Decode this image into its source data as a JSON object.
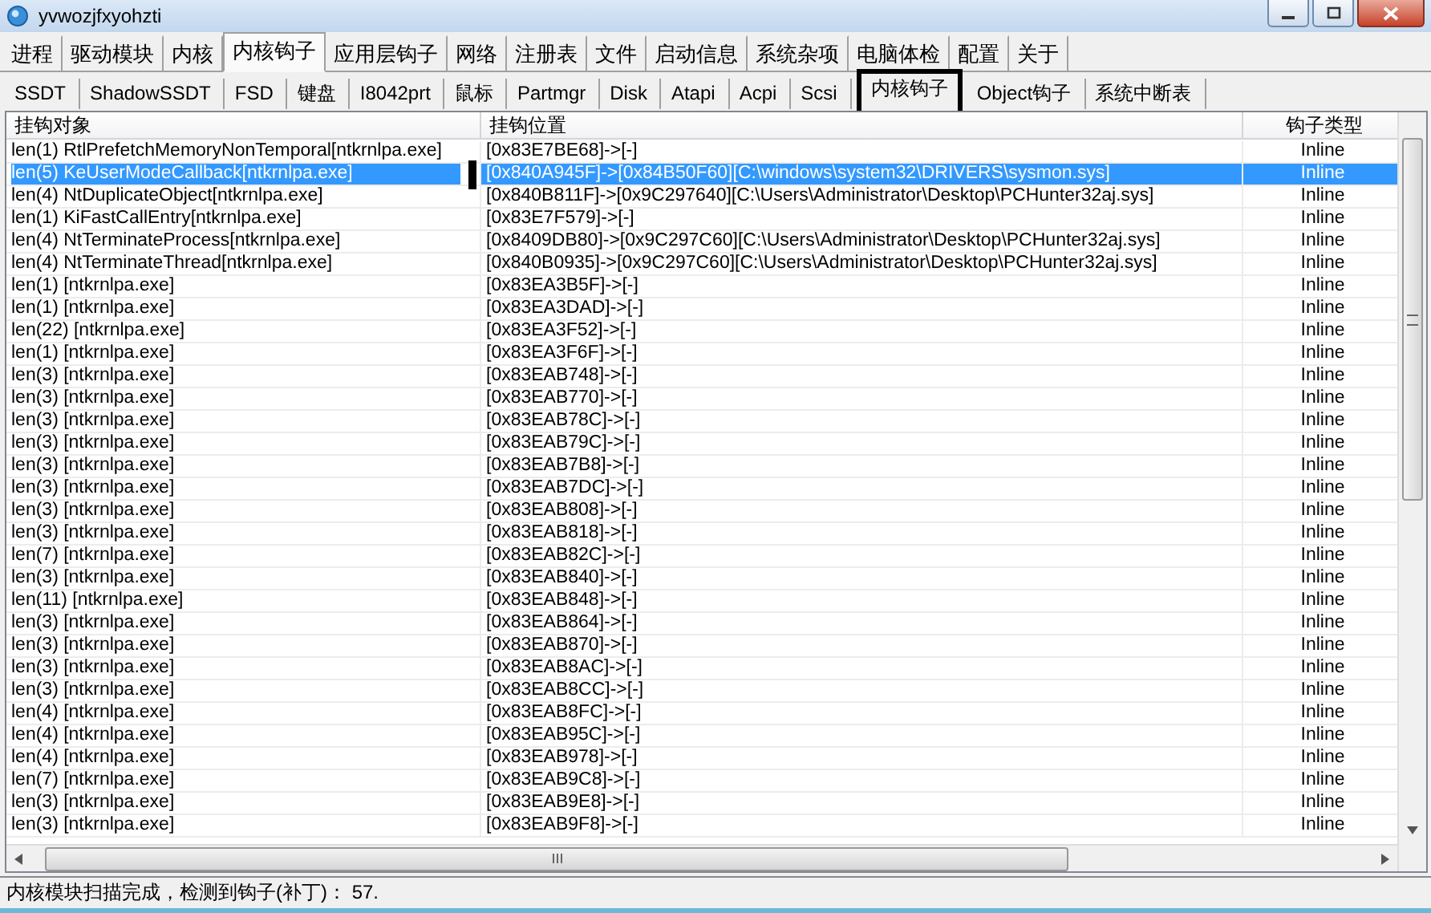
{
  "window": {
    "title": "yvwozjfxyohzti"
  },
  "tabs": [
    {
      "label": "进程",
      "selected": false
    },
    {
      "label": "驱动模块",
      "selected": false
    },
    {
      "label": "内核",
      "selected": false
    },
    {
      "label": "内核钩子",
      "selected": true
    },
    {
      "label": "应用层钩子",
      "selected": false
    },
    {
      "label": "网络",
      "selected": false
    },
    {
      "label": "注册表",
      "selected": false
    },
    {
      "label": "文件",
      "selected": false
    },
    {
      "label": "启动信息",
      "selected": false
    },
    {
      "label": "系统杂项",
      "selected": false
    },
    {
      "label": "电脑体检",
      "selected": false
    },
    {
      "label": "配置",
      "selected": false
    },
    {
      "label": "关于",
      "selected": false
    }
  ],
  "subtabs": [
    {
      "label": "SSDT",
      "selected": false
    },
    {
      "label": "ShadowSSDT",
      "selected": false
    },
    {
      "label": "FSD",
      "selected": false
    },
    {
      "label": "键盘",
      "selected": false
    },
    {
      "label": "I8042prt",
      "selected": false
    },
    {
      "label": "鼠标",
      "selected": false
    },
    {
      "label": "Partmgr",
      "selected": false
    },
    {
      "label": "Disk",
      "selected": false
    },
    {
      "label": "Atapi",
      "selected": false
    },
    {
      "label": "Acpi",
      "selected": false
    },
    {
      "label": "Scsi",
      "selected": false
    },
    {
      "label": "内核钩子",
      "selected": true
    },
    {
      "label": "Object钩子",
      "selected": false
    },
    {
      "label": "系统中断表",
      "selected": false
    }
  ],
  "table": {
    "columns": [
      "挂钩对象",
      "挂钩位置",
      "钩子类型"
    ],
    "rows": [
      {
        "object": "len(1) RtlPrefetchMemoryNonTemporal[ntkrnlpa.exe]",
        "location": "[0x83E7BE68]->[-]",
        "type": "Inline",
        "selected": false
      },
      {
        "object": "len(5) KeUserModeCallback[ntkrnlpa.exe]",
        "location": "[0x840A945F]->[0x84B50F60][C:\\windows\\system32\\DRIVERS\\sysmon.sys]",
        "type": "Inline",
        "selected": true
      },
      {
        "object": "len(4) NtDuplicateObject[ntkrnlpa.exe]",
        "location": "[0x840B811F]->[0x9C297640][C:\\Users\\Administrator\\Desktop\\PCHunter32aj.sys]",
        "type": "Inline",
        "selected": false
      },
      {
        "object": "len(1) KiFastCallEntry[ntkrnlpa.exe]",
        "location": "[0x83E7F579]->[-]",
        "type": "Inline",
        "selected": false
      },
      {
        "object": "len(4) NtTerminateProcess[ntkrnlpa.exe]",
        "location": "[0x8409DB80]->[0x9C297C60][C:\\Users\\Administrator\\Desktop\\PCHunter32aj.sys]",
        "type": "Inline",
        "selected": false
      },
      {
        "object": "len(4) NtTerminateThread[ntkrnlpa.exe]",
        "location": "[0x840B0935]->[0x9C297C60][C:\\Users\\Administrator\\Desktop\\PCHunter32aj.sys]",
        "type": "Inline",
        "selected": false
      },
      {
        "object": "len(1) [ntkrnlpa.exe]",
        "location": "[0x83EA3B5F]->[-]",
        "type": "Inline",
        "selected": false
      },
      {
        "object": "len(1) [ntkrnlpa.exe]",
        "location": "[0x83EA3DAD]->[-]",
        "type": "Inline",
        "selected": false
      },
      {
        "object": "len(22) [ntkrnlpa.exe]",
        "location": "[0x83EA3F52]->[-]",
        "type": "Inline",
        "selected": false
      },
      {
        "object": "len(1) [ntkrnlpa.exe]",
        "location": "[0x83EA3F6F]->[-]",
        "type": "Inline",
        "selected": false
      },
      {
        "object": "len(3) [ntkrnlpa.exe]",
        "location": "[0x83EAB748]->[-]",
        "type": "Inline",
        "selected": false
      },
      {
        "object": "len(3) [ntkrnlpa.exe]",
        "location": "[0x83EAB770]->[-]",
        "type": "Inline",
        "selected": false
      },
      {
        "object": "len(3) [ntkrnlpa.exe]",
        "location": "[0x83EAB78C]->[-]",
        "type": "Inline",
        "selected": false
      },
      {
        "object": "len(3) [ntkrnlpa.exe]",
        "location": "[0x83EAB79C]->[-]",
        "type": "Inline",
        "selected": false
      },
      {
        "object": "len(3) [ntkrnlpa.exe]",
        "location": "[0x83EAB7B8]->[-]",
        "type": "Inline",
        "selected": false
      },
      {
        "object": "len(3) [ntkrnlpa.exe]",
        "location": "[0x83EAB7DC]->[-]",
        "type": "Inline",
        "selected": false
      },
      {
        "object": "len(3) [ntkrnlpa.exe]",
        "location": "[0x83EAB808]->[-]",
        "type": "Inline",
        "selected": false
      },
      {
        "object": "len(3) [ntkrnlpa.exe]",
        "location": "[0x83EAB818]->[-]",
        "type": "Inline",
        "selected": false
      },
      {
        "object": "len(7) [ntkrnlpa.exe]",
        "location": "[0x83EAB82C]->[-]",
        "type": "Inline",
        "selected": false
      },
      {
        "object": "len(3) [ntkrnlpa.exe]",
        "location": "[0x83EAB840]->[-]",
        "type": "Inline",
        "selected": false
      },
      {
        "object": "len(11) [ntkrnlpa.exe]",
        "location": "[0x83EAB848]->[-]",
        "type": "Inline",
        "selected": false
      },
      {
        "object": "len(3) [ntkrnlpa.exe]",
        "location": "[0x83EAB864]->[-]",
        "type": "Inline",
        "selected": false
      },
      {
        "object": "len(3) [ntkrnlpa.exe]",
        "location": "[0x83EAB870]->[-]",
        "type": "Inline",
        "selected": false
      },
      {
        "object": "len(3) [ntkrnlpa.exe]",
        "location": "[0x83EAB8AC]->[-]",
        "type": "Inline",
        "selected": false
      },
      {
        "object": "len(3) [ntkrnlpa.exe]",
        "location": "[0x83EAB8CC]->[-]",
        "type": "Inline",
        "selected": false
      },
      {
        "object": "len(4) [ntkrnlpa.exe]",
        "location": "[0x83EAB8FC]->[-]",
        "type": "Inline",
        "selected": false
      },
      {
        "object": "len(4) [ntkrnlpa.exe]",
        "location": "[0x83EAB95C]->[-]",
        "type": "Inline",
        "selected": false
      },
      {
        "object": "len(4) [ntkrnlpa.exe]",
        "location": "[0x83EAB978]->[-]",
        "type": "Inline",
        "selected": false
      },
      {
        "object": "len(7) [ntkrnlpa.exe]",
        "location": "[0x83EAB9C8]->[-]",
        "type": "Inline",
        "selected": false
      },
      {
        "object": "len(3) [ntkrnlpa.exe]",
        "location": "[0x83EAB9E8]->[-]",
        "type": "Inline",
        "selected": false
      },
      {
        "object": "len(3) [ntkrnlpa.exe]",
        "location": "[0x83EAB9F8]->[-]",
        "type": "Inline",
        "selected": false
      }
    ]
  },
  "status_bar": "内核模块扫描完成，检测到钩子(补丁)： 57."
}
